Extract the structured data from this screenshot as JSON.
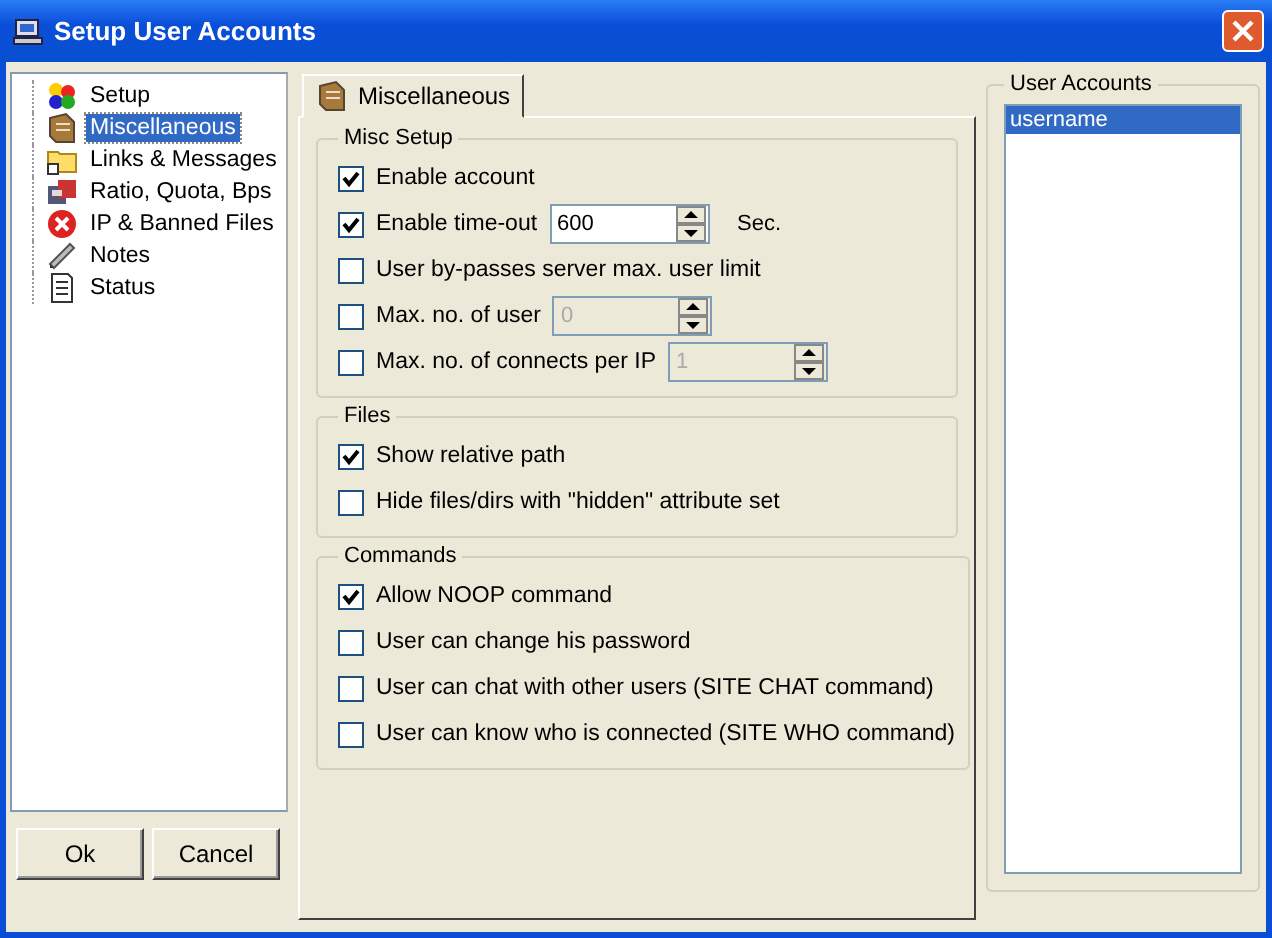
{
  "window": {
    "title": "Setup User Accounts"
  },
  "tree": {
    "items": [
      {
        "label": "Setup",
        "selected": false
      },
      {
        "label": "Miscellaneous",
        "selected": true
      },
      {
        "label": "Links & Messages",
        "selected": false
      },
      {
        "label": "Ratio, Quota, Bps",
        "selected": false
      },
      {
        "label": "IP & Banned Files",
        "selected": false
      },
      {
        "label": "Notes",
        "selected": false
      },
      {
        "label": "Status",
        "selected": false
      }
    ]
  },
  "buttons": [
    "Ok",
    "Cancel"
  ],
  "tabs": [
    {
      "label": "Miscellaneous",
      "selected": true
    }
  ],
  "groups": [
    {
      "title": "Misc Setup",
      "options": [
        {
          "kind": "checkbox",
          "label": "Enable account",
          "checked": true
        },
        {
          "kind": "spin",
          "label": "Enable time-out",
          "checked": true,
          "value": "600",
          "disabled": false,
          "unit": "Sec."
        },
        {
          "kind": "checkbox",
          "label": "User by-passes server max. user limit",
          "checked": false
        },
        {
          "kind": "spin",
          "label": "Max. no. of user",
          "checked": false,
          "value": "0",
          "disabled": true
        },
        {
          "kind": "spin",
          "label": "Max. no. of connects per IP",
          "checked": false,
          "value": "1",
          "disabled": true
        }
      ]
    },
    {
      "title": "Files",
      "options": [
        {
          "kind": "checkbox",
          "label": "Show relative path",
          "checked": true
        },
        {
          "kind": "checkbox",
          "label": "Hide files/dirs with \"hidden\" attribute set",
          "checked": false
        }
      ]
    },
    {
      "title": "Commands",
      "options": [
        {
          "kind": "checkbox",
          "label": "Allow NOOP command",
          "checked": true
        },
        {
          "kind": "checkbox",
          "label": "User can change his password",
          "checked": false
        },
        {
          "kind": "checkbox",
          "label": "User can chat with other users (SITE CHAT command)",
          "checked": false
        },
        {
          "kind": "checkbox",
          "label": "User can know who is connected (SITE WHO command)",
          "checked": false
        }
      ]
    }
  ],
  "accounts": {
    "title": "User Accounts",
    "items": [
      {
        "label": "username",
        "selected": true
      }
    ]
  }
}
